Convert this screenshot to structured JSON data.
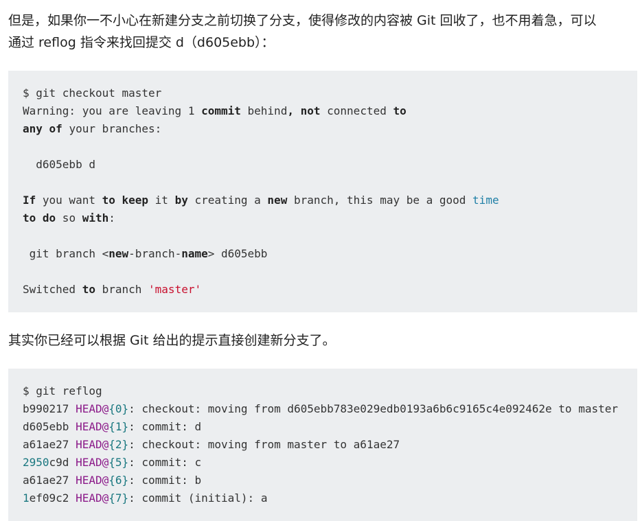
{
  "intro": {
    "line1": "但是，如果你一不小心在新建分支之前切换了分支，使得修改的内容被 Git 回收了，也不用着急，可以",
    "line2": "通过 reflog 指令来找回提交 d（d605ebb）："
  },
  "code1": {
    "l1": "$ git checkout master",
    "l2_a": "Warning: you are leaving 1 ",
    "l2_b": "commit",
    "l2_c": " behind",
    "l2_d": ",",
    "l2_e": " ",
    "l2_f": "not",
    "l2_g": " connected ",
    "l2_h": "to",
    "l3_a": "any",
    "l3_b": " ",
    "l3_c": "of",
    "l3_d": " your branches:",
    "l5": "  d605ebb d",
    "l7_a": "If",
    "l7_b": " you want ",
    "l7_c": "to",
    "l7_d": " ",
    "l7_e": "keep",
    "l7_f": " it ",
    "l7_g": "by",
    "l7_h": " creating a ",
    "l7_i": "new",
    "l7_j": " branch, this may be a good ",
    "l7_k": "time",
    "l8_a": "to",
    "l8_b": " ",
    "l8_c": "do",
    "l8_d": " so ",
    "l8_e": "with",
    "l8_f": ":",
    "l10_a": " git branch <",
    "l10_b": "new",
    "l10_c": "-branch-",
    "l10_d": "name",
    "l10_e": "> d605ebb",
    "l12_a": "Switched ",
    "l12_b": "to",
    "l12_c": " branch ",
    "l12_d": "'master'"
  },
  "middle": {
    "text": "其实你已经可以根据 Git 给出的提示直接创建新分支了。"
  },
  "code2": {
    "cmd": "$ git reflog",
    "head": "HEAD@",
    "rows": [
      {
        "hash": "b990217",
        "num": "{0}",
        "msg": ": checkout: moving from d605ebb783e029edb0193a6b6c9165c4e092462e to master"
      },
      {
        "hash": "d605ebb",
        "num": "{1}",
        "msg": ": commit: d"
      },
      {
        "hash": "a61ae27",
        "num": "{2}",
        "msg": ": checkout: moving from master to a61ae27"
      },
      {
        "hash_num": "2950",
        "hash_rest": "c9d",
        "num": "{5}",
        "msg": ": commit: c"
      },
      {
        "hash": "a61ae27",
        "num": "{6}",
        "msg": ": commit: b"
      },
      {
        "hash_num": "1",
        "hash_rest": "ef09c2",
        "num": "{7}",
        "msg": ": commit (initial): a"
      }
    ]
  }
}
